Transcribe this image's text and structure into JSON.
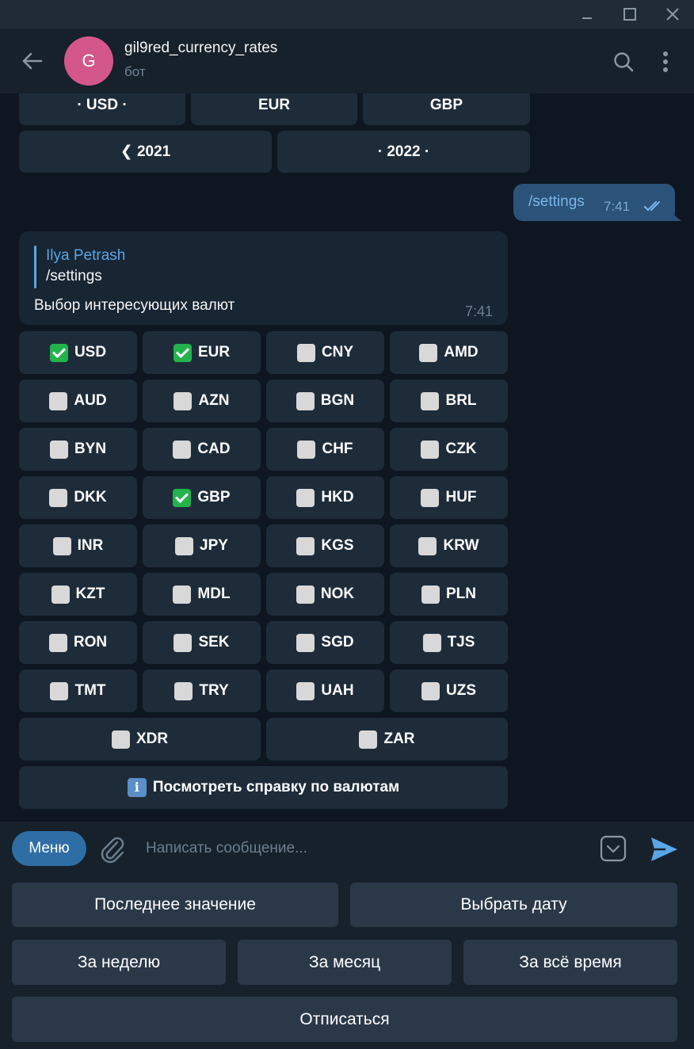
{
  "header": {
    "avatar_letter": "G",
    "title": "gil9red_currency_rates",
    "subtitle": "бот"
  },
  "prev_keyboard": {
    "row1": [
      "· USD ·",
      "EUR",
      "GBP"
    ],
    "row2": [
      "❮ 2021",
      "· 2022 ·"
    ]
  },
  "outgoing": {
    "text": "/settings",
    "time": "7:41"
  },
  "incoming": {
    "reply_author": "Ilya Petrash",
    "reply_text": "/settings",
    "text": "Выбор интересующих валют",
    "time": "7:41"
  },
  "currencies": [
    {
      "code": "USD",
      "checked": true
    },
    {
      "code": "EUR",
      "checked": true
    },
    {
      "code": "CNY",
      "checked": false
    },
    {
      "code": "AMD",
      "checked": false
    },
    {
      "code": "AUD",
      "checked": false
    },
    {
      "code": "AZN",
      "checked": false
    },
    {
      "code": "BGN",
      "checked": false
    },
    {
      "code": "BRL",
      "checked": false
    },
    {
      "code": "BYN",
      "checked": false
    },
    {
      "code": "CAD",
      "checked": false
    },
    {
      "code": "CHF",
      "checked": false
    },
    {
      "code": "CZK",
      "checked": false
    },
    {
      "code": "DKK",
      "checked": false
    },
    {
      "code": "GBP",
      "checked": true
    },
    {
      "code": "HKD",
      "checked": false
    },
    {
      "code": "HUF",
      "checked": false
    },
    {
      "code": "INR",
      "checked": false
    },
    {
      "code": "JPY",
      "checked": false
    },
    {
      "code": "KGS",
      "checked": false
    },
    {
      "code": "KRW",
      "checked": false
    },
    {
      "code": "KZT",
      "checked": false
    },
    {
      "code": "MDL",
      "checked": false
    },
    {
      "code": "NOK",
      "checked": false
    },
    {
      "code": "PLN",
      "checked": false
    },
    {
      "code": "RON",
      "checked": false
    },
    {
      "code": "SEK",
      "checked": false
    },
    {
      "code": "SGD",
      "checked": false
    },
    {
      "code": "TJS",
      "checked": false
    },
    {
      "code": "TMT",
      "checked": false
    },
    {
      "code": "TRY",
      "checked": false
    },
    {
      "code": "UAH",
      "checked": false
    },
    {
      "code": "UZS",
      "checked": false
    }
  ],
  "currencies_last": [
    {
      "code": "XDR",
      "checked": false
    },
    {
      "code": "ZAR",
      "checked": false
    }
  ],
  "help_button": "Посмотреть справку по валютам",
  "composer": {
    "menu_label": "Меню",
    "placeholder": "Написать сообщение..."
  },
  "reply_keyboard": {
    "row1": [
      "Последнее значение",
      "Выбрать дату"
    ],
    "row2": [
      "За неделю",
      "За месяц",
      "За всё время"
    ],
    "row3": "Отписаться"
  },
  "colors": {
    "background": "#0e1621",
    "panel": "#17212b",
    "button": "#1e2c3a",
    "outgoing_bubble": "#2b5278",
    "accent": "#5aa6e6",
    "avatar": "#d3578a",
    "check_on": "#22b34c",
    "check_off": "#d8d8d8"
  }
}
